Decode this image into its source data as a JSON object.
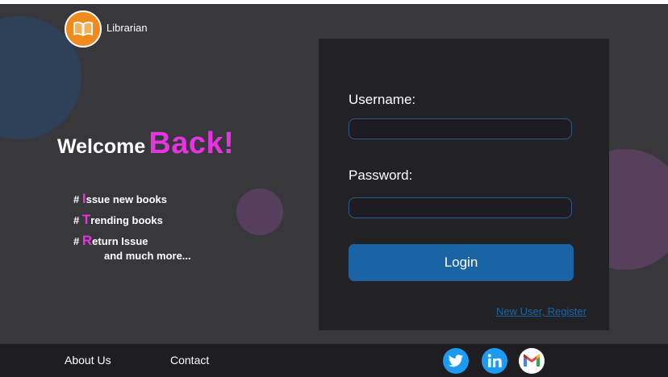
{
  "brand": {
    "name": "Librarian",
    "icon": "open-book-icon",
    "icon_color": "#f08a1c"
  },
  "hero": {
    "welcome": "Welcome",
    "back": "Back!",
    "features": [
      {
        "hash": "#",
        "initial": "I",
        "rest": "ssue new books"
      },
      {
        "hash": "#",
        "initial": "T",
        "rest": "rending books"
      },
      {
        "hash": "#",
        "initial": "R",
        "rest": "eturn Issue"
      }
    ],
    "more": "and much more..."
  },
  "login": {
    "username_label": "Username:",
    "username_value": "",
    "password_label": "Password:",
    "password_value": "",
    "button_label": "Login",
    "register_link": "New User, Register"
  },
  "footer": {
    "links": [
      "About Us",
      "Contact"
    ],
    "social": [
      {
        "icon": "twitter-icon",
        "color": "#1d9bf0"
      },
      {
        "icon": "linkedin-icon",
        "color": "#1d9bf0"
      },
      {
        "icon": "gmail-icon",
        "color": "#ffffff"
      }
    ]
  },
  "colors": {
    "background": "#38383c",
    "panel": "#222226",
    "accent_pink": "#e534e0",
    "button_blue": "#1a64a6",
    "footer": "#1e1e22"
  }
}
